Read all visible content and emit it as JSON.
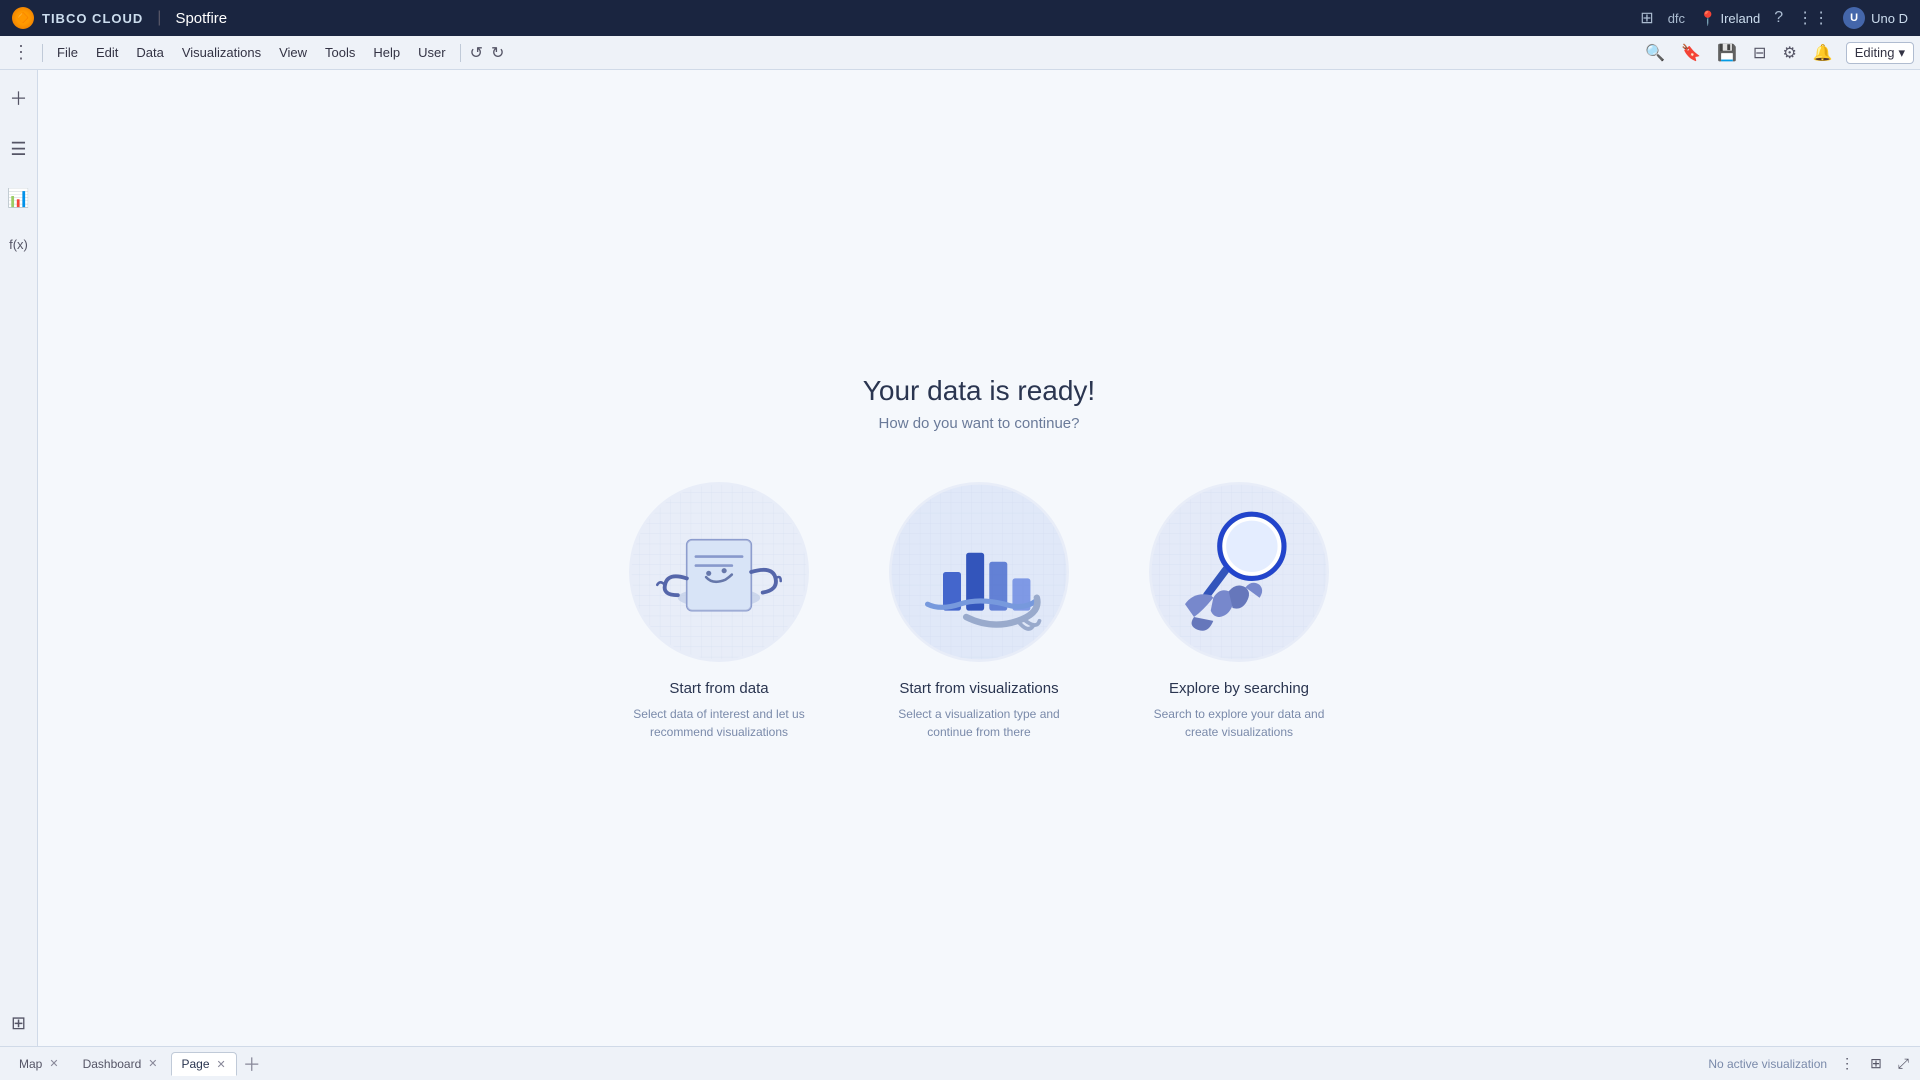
{
  "topbar": {
    "logo_text": "TIBCO CLOUD",
    "app_name": "Spotfire",
    "location": "Ireland",
    "user": "Uno D",
    "user_initials": "U",
    "dfc_label": "dfc",
    "editing_label": "Editing"
  },
  "menubar": {
    "items": [
      "File",
      "Edit",
      "Data",
      "Visualizations",
      "View",
      "Tools",
      "Help",
      "User"
    ]
  },
  "main": {
    "title": "Your data is ready!",
    "subtitle": "How do you want to continue?",
    "cards": [
      {
        "id": "start-from-data",
        "title": "Start from data",
        "desc": "Select data of interest and let us recommend visualizations"
      },
      {
        "id": "start-from-visualizations",
        "title": "Start from visualizations",
        "desc": "Select a visualization type and continue from there"
      },
      {
        "id": "explore-by-searching",
        "title": "Explore by searching",
        "desc": "Search to explore your data and create visualizations"
      }
    ]
  },
  "tabs": [
    {
      "label": "Map",
      "active": false
    },
    {
      "label": "Dashboard",
      "active": false
    },
    {
      "label": "Page",
      "active": true
    }
  ],
  "tabbar": {
    "status": "No active visualization"
  }
}
